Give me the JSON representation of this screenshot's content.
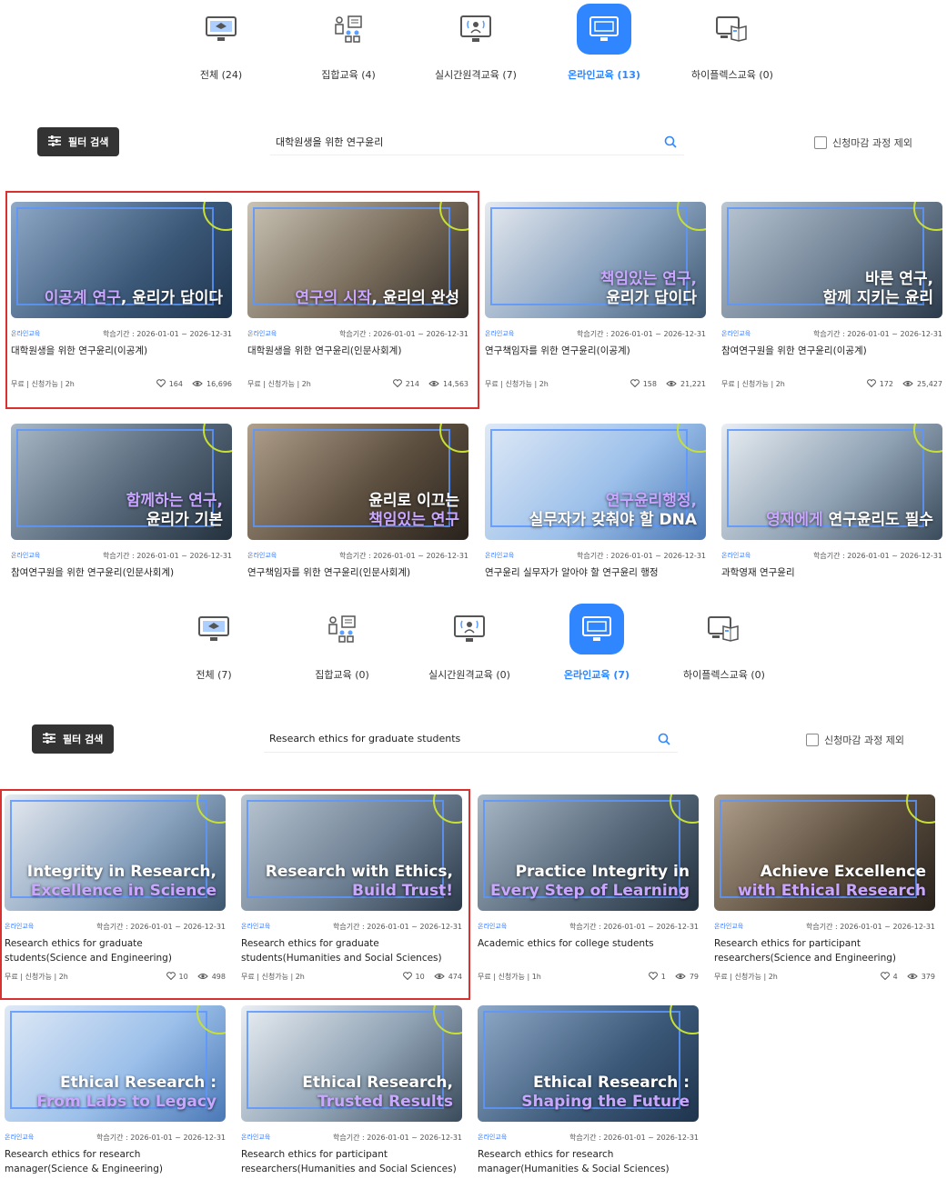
{
  "ko": {
    "categories": [
      {
        "label": "전체 (24)",
        "icon": "classroom-monitor-icon"
      },
      {
        "label": "집합교육 (4)",
        "icon": "group-board-icon"
      },
      {
        "label": "실시간원격교육 (7)",
        "icon": "live-stream-icon"
      },
      {
        "label": "온라인교육 (13)",
        "icon": "online-monitor-icon",
        "active": true
      },
      {
        "label": "하이플렉스교육 (0)",
        "icon": "hyflex-book-icon"
      }
    ],
    "filter_label": "필터 검색",
    "search_value": "대학원생을 위한 연구윤리",
    "exclude_closed_label": "신청마감 과정 제외",
    "cards": [
      {
        "thumb_pre": "이공계 연구",
        "thumb_mid": ", 윤리가 답이다",
        "thumb_line2": "",
        "badge": "온라인교육",
        "period": "학습기간 : 2026-01-01 ~ 2026-12-31",
        "title": "대학원생을 위한 연구윤리(이공계)",
        "info": "무료 | 신청가능 | 2h",
        "likes": "164",
        "views": "16,696"
      },
      {
        "thumb_pre": "연구의 시작",
        "thumb_mid": ", 윤리의 완성",
        "thumb_line2": "",
        "badge": "온라인교육",
        "period": "학습기간 : 2026-01-01 ~ 2026-12-31",
        "title": "대학원생을 위한 연구윤리(인문사회계)",
        "info": "무료 | 신청가능 | 2h",
        "likes": "214",
        "views": "14,563"
      },
      {
        "thumb_pre": "책임있는 연구,",
        "thumb_mid": "",
        "thumb_line2": "윤리가 답이다",
        "badge": "온라인교육",
        "period": "학습기간 : 2026-01-01 ~ 2026-12-31",
        "title": "연구책임자를 위한 연구윤리(이공계)",
        "info": "무료 | 신청가능 | 2h",
        "likes": "158",
        "views": "21,221"
      },
      {
        "thumb_pre": "바른 연구,",
        "thumb_mid": "",
        "thumb_line2": "함께 지키는 윤리",
        "badge": "온라인교육",
        "period": "학습기간 : 2026-01-01 ~ 2026-12-31",
        "title": "참여연구원을 위한 연구윤리(이공계)",
        "info": "무료 | 신청가능 | 2h",
        "likes": "172",
        "views": "25,427"
      },
      {
        "thumb_pre": "함께하는 연구,",
        "thumb_mid": "",
        "thumb_line2": "윤리가 기본",
        "badge": "온라인교육",
        "period": "학습기간 : 2026-01-01 ~ 2026-12-31",
        "title": "참여연구원을 위한 연구윤리(인문사회계)"
      },
      {
        "thumb_pre": "윤리로 이끄는",
        "thumb_mid": "",
        "thumb_line2": "책임있는 연구",
        "badge": "온라인교육",
        "period": "학습기간 : 2026-01-01 ~ 2026-12-31",
        "title": "연구책임자를 위한 연구윤리(인문사회계)"
      },
      {
        "thumb_pre": "연구윤리행정,",
        "thumb_mid": "",
        "thumb_line2": "실무자가 갖춰야 할 DNA",
        "badge": "온라인교육",
        "period": "학습기간 : 2026-01-01 ~ 2026-12-31",
        "title": "연구윤리 실무자가 알아야 할 연구윤리 행정"
      },
      {
        "thumb_pre": "영재에게",
        "thumb_mid": " 연구윤리도 필수",
        "thumb_line2": "",
        "badge": "온라인교육",
        "period": "학습기간 : 2026-01-01 ~ 2026-12-31",
        "title": "과학영재 연구윤리"
      }
    ]
  },
  "en": {
    "categories": [
      {
        "label": "전체 (7)",
        "icon": "classroom-monitor-icon"
      },
      {
        "label": "집합교육 (0)",
        "icon": "group-board-icon"
      },
      {
        "label": "실시간원격교육 (0)",
        "icon": "live-stream-icon"
      },
      {
        "label": "온라인교육 (7)",
        "icon": "online-monitor-icon",
        "active": true
      },
      {
        "label": "하이플렉스교육 (0)",
        "icon": "hyflex-book-icon"
      }
    ],
    "filter_label": "필터 검색",
    "search_value": "Research ethics for graduate students",
    "exclude_closed_label": "신청마감 과정 제외",
    "cards": [
      {
        "thumb_pre": "Integrity in Research,",
        "thumb_mid": "",
        "thumb_line2": "Excellence in Science",
        "badge": "온라인교육",
        "period": "학습기간 : 2026-01-01 ~ 2026-12-31",
        "title": "Research ethics for graduate students(Science and Engineering)",
        "info": "무료 | 신청가능 | 2h",
        "likes": "10",
        "views": "498"
      },
      {
        "thumb_pre": "Research with Ethics,",
        "thumb_mid": "",
        "thumb_line2": "Build Trust!",
        "badge": "온라인교육",
        "period": "학습기간 : 2026-01-01 ~ 2026-12-31",
        "title": "Research ethics for graduate students(Humanities and Social Sciences)",
        "info": "무료 | 신청가능 | 2h",
        "likes": "10",
        "views": "474"
      },
      {
        "thumb_pre": "Practice Integrity in",
        "thumb_mid": "",
        "thumb_line2": "Every Step of Learning",
        "badge": "온라인교육",
        "period": "학습기간 : 2026-01-01 ~ 2026-12-31",
        "title": "Academic ethics for college students",
        "info": "무료 | 신청가능 | 1h",
        "likes": "1",
        "views": "79"
      },
      {
        "thumb_pre": "Achieve Excellence",
        "thumb_mid": "",
        "thumb_line2": "with Ethical Research",
        "badge": "온라인교육",
        "period": "학습기간 : 2026-01-01 ~ 2026-12-31",
        "title": "Research ethics for participant researchers(Science and Engineering)",
        "info": "무료 | 신청가능 | 2h",
        "likes": "4",
        "views": "379"
      },
      {
        "thumb_pre": "Ethical Research :",
        "thumb_mid": "",
        "thumb_line2": "From Labs to Legacy",
        "badge": "온라인교육",
        "period": "학습기간 : 2026-01-01 ~ 2026-12-31",
        "title": "Research ethics for research manager(Science & Engineering)"
      },
      {
        "thumb_pre": "Ethical Research,",
        "thumb_mid": "",
        "thumb_line2": "Trusted Results",
        "badge": "온라인교육",
        "period": "학습기간 : 2026-01-01 ~ 2026-12-31",
        "title": "Research ethics for participant researchers(Humanities and Social Sciences)"
      },
      {
        "thumb_pre": "Ethical Research :",
        "thumb_mid": "",
        "thumb_line2": "Shaping the Future",
        "badge": "온라인교육",
        "period": "학습기간 : 2026-01-01 ~ 2026-12-31",
        "title": "Research ethics for research manager(Humanities & Social Sciences)"
      }
    ]
  },
  "colors": {
    "accent": "#2f86ff",
    "highlight_box": "#d93030",
    "badge": "#3b7dff",
    "thumb_highlight": "#c9a6ff"
  }
}
